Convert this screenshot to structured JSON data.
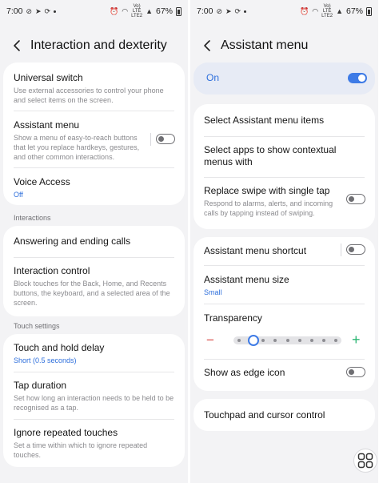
{
  "status_bar": {
    "time": "7:00",
    "volte_top": "Vo)",
    "volte_mid": "LTE",
    "volte_bot": "LTE2",
    "battery": "67%"
  },
  "left": {
    "title": "Interaction and dexterity",
    "items": {
      "universal_switch": {
        "title": "Universal switch",
        "desc": "Use external accessories to control your phone and select items on the screen."
      },
      "assistant_menu": {
        "title": "Assistant menu",
        "desc": "Show a menu of easy-to-reach buttons that let you replace hardkeys, gestures, and other common interactions."
      },
      "voice_access": {
        "title": "Voice Access",
        "sub": "Off"
      },
      "answering_calls": {
        "title": "Answering and ending calls"
      },
      "interaction_control": {
        "title": "Interaction control",
        "desc": "Block touches for the Back, Home, and Recents buttons, the keyboard, and a selected area of the screen."
      },
      "touch_hold": {
        "title": "Touch and hold delay",
        "sub": "Short (0.5 seconds)"
      },
      "tap_duration": {
        "title": "Tap duration",
        "desc": "Set how long an interaction needs to be held to be recognised as a tap."
      },
      "ignore_repeated": {
        "title": "Ignore repeated touches",
        "desc": "Set a time within which to ignore repeated touches."
      }
    },
    "sections": {
      "interactions": "Interactions",
      "touch_settings": "Touch settings"
    }
  },
  "right": {
    "title": "Assistant menu",
    "on_label": "On",
    "items": {
      "select_items": {
        "title": "Select Assistant menu items"
      },
      "select_apps": {
        "title": "Select apps to show contextual menus with"
      },
      "replace_swipe": {
        "title": "Replace swipe with single tap",
        "desc": "Respond to alarms, alerts, and incoming calls by tapping instead of swiping."
      },
      "shortcut": {
        "title": "Assistant menu shortcut"
      },
      "size": {
        "title": "Assistant menu size",
        "sub": "Small"
      },
      "transparency": {
        "title": "Transparency",
        "minus": "−",
        "plus": "+",
        "level": 0.15
      },
      "edge_icon": {
        "title": "Show as edge icon"
      },
      "touchpad": {
        "title": "Touchpad and cursor control"
      }
    }
  },
  "colors": {
    "accent": "#3e7be6",
    "link": "#2e6fdc",
    "minus": "#d9534f",
    "plus": "#2bb673"
  }
}
